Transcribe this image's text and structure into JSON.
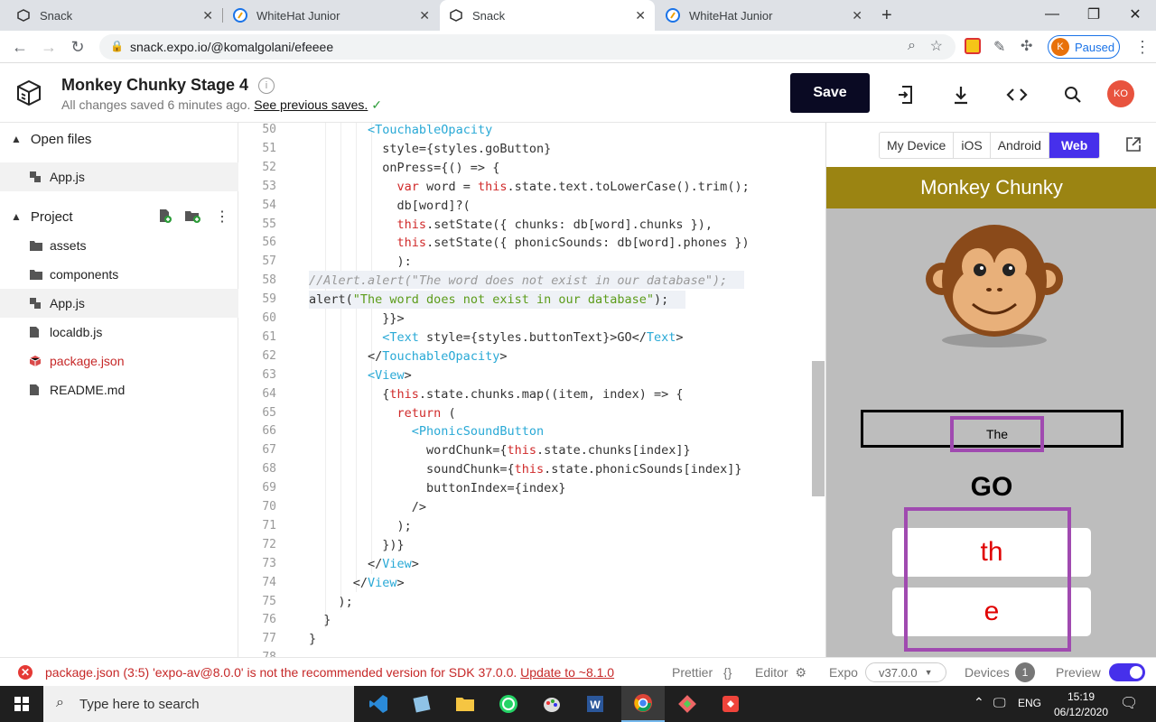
{
  "browser": {
    "tabs": [
      {
        "title": "Snack",
        "icon": "snack-icon",
        "active": false
      },
      {
        "title": "WhiteHat Junior",
        "icon": "whitehat-icon",
        "active": false
      },
      {
        "title": "Snack",
        "icon": "snack-icon",
        "active": true
      },
      {
        "title": "WhiteHat Junior",
        "icon": "whitehat-icon",
        "active": false
      }
    ],
    "url": "snack.expo.io/@komalgolani/efeeee",
    "profile_initial": "K",
    "profile_status": "Paused"
  },
  "header": {
    "title": "Monkey Chunky Stage 4",
    "saved_text": "All changes saved 6 minutes ago.",
    "saves_link": "See previous saves.",
    "save_label": "Save",
    "avatar": "KO"
  },
  "sidebar": {
    "open_files_label": "Open files",
    "open_files": [
      "App.js"
    ],
    "project_label": "Project",
    "items": [
      {
        "name": "assets",
        "type": "folder"
      },
      {
        "name": "components",
        "type": "folder"
      },
      {
        "name": "App.js",
        "type": "js",
        "selected": true
      },
      {
        "name": "localdb.js",
        "type": "file"
      },
      {
        "name": "package.json",
        "type": "package",
        "error": true
      },
      {
        "name": "README.md",
        "type": "file"
      }
    ]
  },
  "editor": {
    "lines": [
      {
        "n": "50",
        "html": "        <span class='t'>&lt;TouchableOpacity</span>"
      },
      {
        "n": "51",
        "html": "          style={styles.goButton}"
      },
      {
        "n": "52",
        "html": "          onPress={() =&gt; {"
      },
      {
        "n": "53",
        "html": "            <span class='k'>var</span> word = <span class='k'>this</span>.state.text.toLowerCase().trim();"
      },
      {
        "n": "54",
        "html": "            db[word]?("
      },
      {
        "n": "55",
        "html": "            <span class='k'>this</span>.setState({ chunks: db[word].chunks }),"
      },
      {
        "n": "56",
        "html": "            <span class='k'>this</span>.setState({ phonicSounds: db[word].phones })"
      },
      {
        "n": "57",
        "html": "            ):"
      },
      {
        "n": "58",
        "html": "<span class='c'>//Alert.alert(\"The word does not exist in our database\");</span>"
      },
      {
        "n": "59",
        "html": "alert(<span class='s'>\"The word does not exist in our database\"</span>);"
      },
      {
        "n": "60",
        "html": "          }}&gt;"
      },
      {
        "n": "61",
        "html": "          <span class='t'>&lt;Text</span> style={styles.buttonText}&gt;GO&lt;/<span class='t'>Text</span>&gt;"
      },
      {
        "n": "62",
        "html": "        &lt;/<span class='t'>TouchableOpacity</span>&gt;"
      },
      {
        "n": "63",
        "html": "        <span class='t'>&lt;View</span>&gt;"
      },
      {
        "n": "64",
        "html": "          {<span class='k'>this</span>.state.chunks.map((item, index) =&gt; {"
      },
      {
        "n": "65",
        "html": "            <span class='k'>return</span> ("
      },
      {
        "n": "66",
        "html": "              <span class='t'>&lt;PhonicSoundButton</span>"
      },
      {
        "n": "67",
        "html": "                wordChunk={<span class='k'>this</span>.state.chunks[index]}"
      },
      {
        "n": "68",
        "html": "                soundChunk={<span class='k'>this</span>.state.phonicSounds[index]}"
      },
      {
        "n": "69",
        "html": "                buttonIndex={index}"
      },
      {
        "n": "70",
        "html": "              /&gt;"
      },
      {
        "n": "71",
        "html": "            );"
      },
      {
        "n": "72",
        "html": "          })}"
      },
      {
        "n": "73",
        "html": "        &lt;/<span class='t'>View</span>&gt;"
      },
      {
        "n": "74",
        "html": "      &lt;/<span class='t'>View</span>&gt;"
      },
      {
        "n": "75",
        "html": "    );"
      },
      {
        "n": "76",
        "html": "  }"
      },
      {
        "n": "77",
        "html": "}"
      },
      {
        "n": "78",
        "html": ""
      }
    ]
  },
  "preview": {
    "device_tabs": [
      "My Device",
      "iOS",
      "Android",
      "Web"
    ],
    "active_tab": "Web",
    "app_title": "Monkey Chunky",
    "input_value": "The",
    "go_label": "GO",
    "chunks": [
      "th",
      "e"
    ]
  },
  "statusbar": {
    "error": "package.json (3:5) 'expo-av@8.0.0' is not the recommended version for SDK 37.0.0.",
    "update_link": "Update to ~8.1.0",
    "prettier": "Prettier",
    "editor": "Editor",
    "expo": "Expo",
    "version": "v37.0.0",
    "devices": "Devices",
    "devices_count": "1",
    "preview": "Preview"
  },
  "taskbar": {
    "search_placeholder": "Type here to search",
    "lang": "ENG",
    "time": "15:19",
    "date": "06/12/2020"
  },
  "colors": {
    "accent": "#4630eb",
    "save_bg": "#0a0a23",
    "app_header": "#9b8412",
    "error": "#c62828",
    "chunk_text": "#e00000",
    "highlight_border": "#a04ab0"
  }
}
